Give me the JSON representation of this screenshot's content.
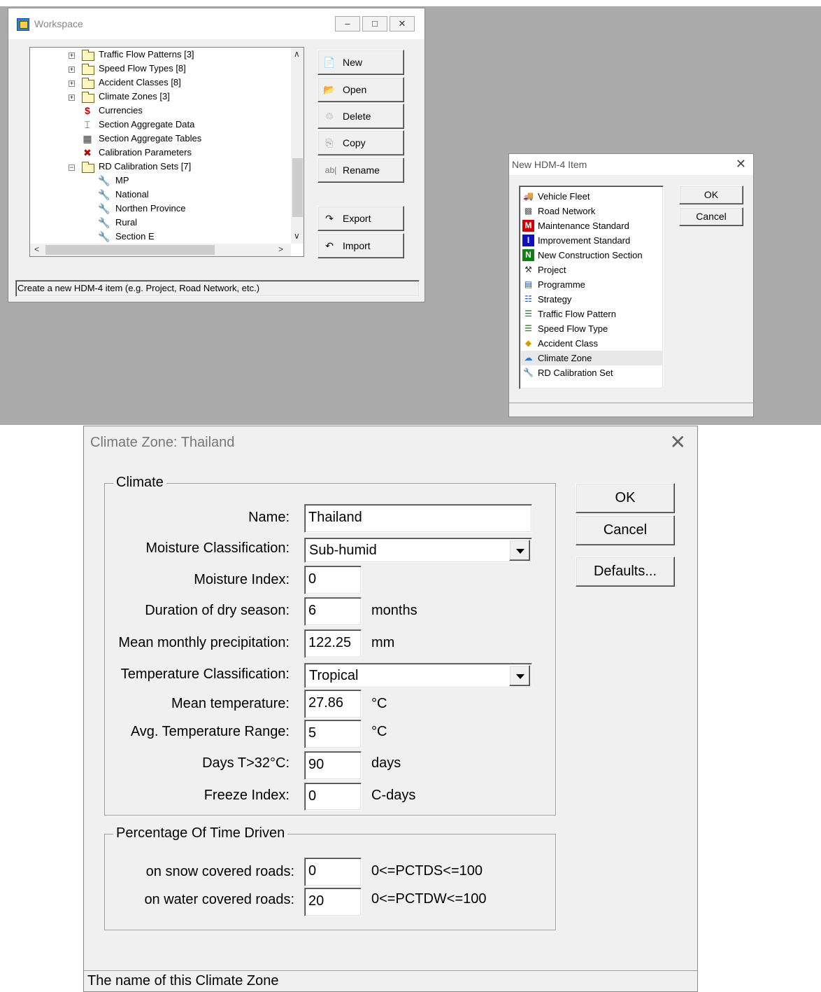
{
  "workspace": {
    "title": "Workspace",
    "tree": [
      {
        "label": "Traffic Flow Patterns [3]",
        "icon": "folder-icon"
      },
      {
        "label": "Speed Flow Types [8]",
        "icon": "folder-icon"
      },
      {
        "label": "Accident Classes [8]",
        "icon": "folder-icon"
      },
      {
        "label": "Climate Zones [3]",
        "icon": "folder-icon"
      },
      {
        "label": "Currencies",
        "icon": "currency-icon"
      },
      {
        "label": "Section Aggregate Data",
        "icon": "aggregate-data-icon"
      },
      {
        "label": "Section Aggregate Tables",
        "icon": "table-icon"
      },
      {
        "label": "Calibration Parameters",
        "icon": "calibration-icon"
      },
      {
        "label": "RD Calibration Sets [7]",
        "icon": "folder-open-icon"
      },
      {
        "label": "MP",
        "icon": "wrench-icon"
      },
      {
        "label": "National",
        "icon": "wrench-icon"
      },
      {
        "label": "Northen Province",
        "icon": "wrench-icon"
      },
      {
        "label": "Rural",
        "icon": "wrench-icon"
      },
      {
        "label": "Section E",
        "icon": "wrench-icon"
      }
    ],
    "buttons": {
      "new": "New",
      "open": "Open",
      "delete": "Delete",
      "copy": "Copy",
      "rename": "Rename",
      "export": "Export",
      "import": "Import"
    },
    "status": "Create a new HDM-4 item (e.g. Project, Road Network, etc.)"
  },
  "new_item_dialog": {
    "title": "New HDM-4 Item",
    "items": [
      {
        "label": "Vehicle Fleet",
        "icon": "vehicle-fleet-icon"
      },
      {
        "label": "Road Network",
        "icon": "road-network-icon"
      },
      {
        "label": "Maintenance Standard",
        "icon": "maintenance-standard-icon"
      },
      {
        "label": "Improvement Standard",
        "icon": "improvement-standard-icon"
      },
      {
        "label": "New Construction Section",
        "icon": "new-construction-icon"
      },
      {
        "label": "Project",
        "icon": "project-icon"
      },
      {
        "label": "Programme",
        "icon": "programme-icon"
      },
      {
        "label": "Strategy",
        "icon": "strategy-icon"
      },
      {
        "label": "Traffic Flow Pattern",
        "icon": "traffic-flow-icon"
      },
      {
        "label": "Speed Flow Type",
        "icon": "speed-flow-icon"
      },
      {
        "label": "Accident Class",
        "icon": "accident-class-icon"
      },
      {
        "label": "Climate Zone",
        "icon": "climate-zone-icon"
      },
      {
        "label": "RD Calibration Set",
        "icon": "wrench-icon"
      }
    ],
    "selected": "Climate Zone",
    "ok": "OK",
    "cancel": "Cancel"
  },
  "climate_dialog": {
    "title": "Climate Zone: Thailand",
    "climate_group": "Climate",
    "fields": {
      "name_label": "Name:",
      "name_value": "Thailand",
      "moisture_class_label": "Moisture Classification:",
      "moisture_class_value": "Sub-humid",
      "moisture_index_label": "Moisture Index:",
      "moisture_index_value": "0",
      "dry_season_label": "Duration of dry season:",
      "dry_season_value": "6",
      "dry_season_unit": "months",
      "precip_label": "Mean monthly precipitation:",
      "precip_value": "122.25",
      "precip_unit": "mm",
      "temp_class_label": "Temperature Classification:",
      "temp_class_value": "Tropical",
      "mean_temp_label": "Mean temperature:",
      "mean_temp_value": "27.86",
      "mean_temp_unit": "°C",
      "temp_range_label": "Avg. Temperature Range:",
      "temp_range_value": "5",
      "temp_range_unit": "°C",
      "days_label": "Days T>32°C:",
      "days_value": "90",
      "days_unit": "days",
      "freeze_label": "Freeze Index:",
      "freeze_value": "0",
      "freeze_unit": "C-days"
    },
    "pct_group": "Percentage Of Time Driven",
    "pct": {
      "snow_label": "on snow covered roads:",
      "snow_value": "0",
      "snow_range": "0<=PCTDS<=100",
      "water_label": "on water covered roads:",
      "water_value": "20",
      "water_range": "0<=PCTDW<=100"
    },
    "buttons": {
      "ok": "OK",
      "cancel": "Cancel",
      "defaults": "Defaults..."
    },
    "status": "The name of this Climate Zone"
  }
}
